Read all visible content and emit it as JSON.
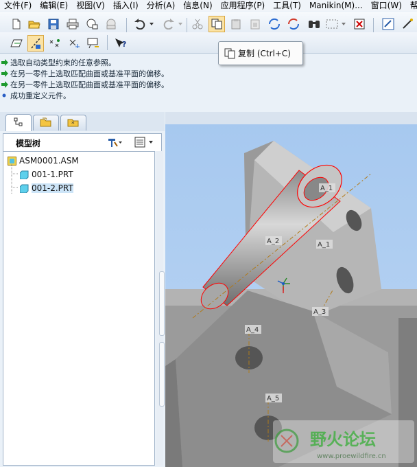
{
  "menubar": {
    "items": [
      "文件(F)",
      "编辑(E)",
      "视图(V)",
      "插入(I)",
      "分析(A)",
      "信息(N)",
      "应用程序(P)",
      "工具(T)",
      "Manikin(M)...",
      "窗口(W)",
      "帮"
    ]
  },
  "toolbar": {
    "icons": [
      "new-file-icon",
      "open-folder-icon",
      "save-icon",
      "print-icon",
      "email-icon",
      "send-icon",
      "undo-icon",
      "redo-icon",
      "cut-icon",
      "copy-icon",
      "paste-icon",
      "paste-special-icon",
      "regenerate-icon",
      "regenerate-manager-icon",
      "find-icon",
      "select-box-icon",
      "close-window-icon",
      "model-player-icon",
      "snap-icon"
    ],
    "row2_icons": [
      "datum-plane-icon",
      "datum-axis-icon",
      "datum-point-icon",
      "csys-icon",
      "annotation-icon",
      "context-help-icon"
    ]
  },
  "tooltip": {
    "text": "复制 (Ctrl+C)"
  },
  "messages": [
    {
      "icon": "arrow-right-icon",
      "text": "选取自动类型约束的任意参照。"
    },
    {
      "icon": "arrow-right-icon",
      "text": "在另一零件上选取匹配曲面或基准平面的偏移。"
    },
    {
      "icon": "arrow-right-icon",
      "text": "在另一零件上选取匹配曲面或基准平面的偏移。"
    },
    {
      "icon": "bullet-icon",
      "text": "成功重定义元件。"
    }
  ],
  "model_tree": {
    "title": "模型树",
    "root": "ASM0001.ASM",
    "children": [
      "001-1.PRT",
      "001-2.PRT"
    ],
    "selected_index": 1
  },
  "viewport": {
    "axis_labels": [
      "A_1",
      "A_1",
      "A_2",
      "A_3",
      "A_4",
      "A_5"
    ],
    "selection_color": "#ff0000",
    "background_color": "#a9ccf2"
  },
  "watermark": {
    "text": "野火论坛",
    "url": "www.proewildfire.cn"
  }
}
